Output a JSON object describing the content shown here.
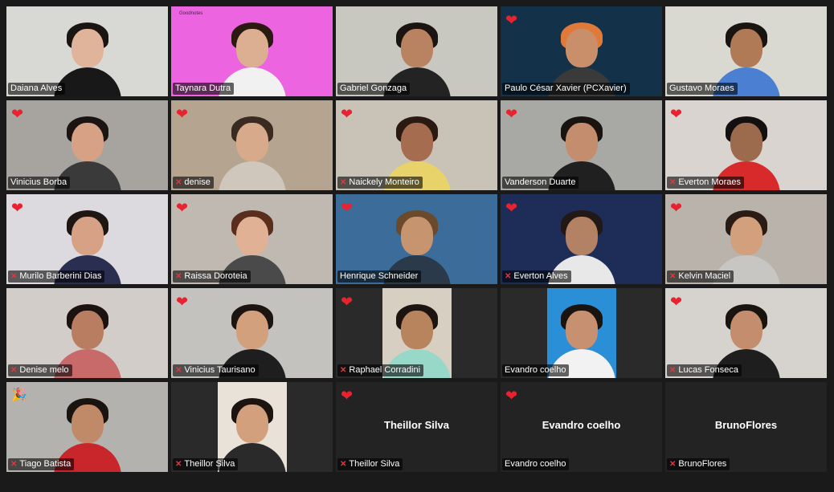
{
  "participants": [
    {
      "name": "Daiana Alves",
      "mic_off": false,
      "reaction": "",
      "active": true,
      "bg": "#d8d8d4",
      "skin": "#e0b49a",
      "hair": "#1a1412",
      "shirt": "#181818"
    },
    {
      "name": "Taynara Dutra",
      "mic_off": false,
      "reaction": "",
      "bg": "#ec64df",
      "skin": "#dcae92",
      "hair": "#2a1a12",
      "shirt": "#f1f1f1",
      "sign": "Goodnotes"
    },
    {
      "name": "Gabriel Gonzaga",
      "mic_off": false,
      "reaction": "",
      "bg": "#c8c8c0",
      "skin": "#b98260",
      "hair": "#1c1410",
      "shirt": "#232323"
    },
    {
      "name": "Paulo César Xavier (PCXavier)",
      "mic_off": false,
      "reaction": "heart",
      "bg": "#13324a",
      "skin": "#c98f6b",
      "hair": "#e07a3a",
      "shirt": "#3a3a3a"
    },
    {
      "name": "Gustavo Moraes",
      "mic_off": false,
      "reaction": "",
      "bg": "#d9d9d2",
      "skin": "#b07a56",
      "hair": "#1a1410",
      "shirt": "#4a7fd1"
    },
    {
      "name": "Vinicius Borba",
      "mic_off": false,
      "reaction": "heart",
      "bg": "#a7a4a0",
      "skin": "#d6a184",
      "hair": "#1b1412",
      "shirt": "#3a3a3a"
    },
    {
      "name": "denise",
      "mic_off": true,
      "reaction": "heart",
      "bg": "#b5a48f",
      "skin": "#d8aa8c",
      "hair": "#3a2a20",
      "shirt": "#cfc7bb"
    },
    {
      "name": "Naickely Monteiro",
      "mic_off": true,
      "reaction": "heart",
      "bg": "#c9c2b6",
      "skin": "#a66c4f",
      "hair": "#2a1a12",
      "shirt": "#e8d36a"
    },
    {
      "name": "Vanderson Duarte",
      "mic_off": false,
      "reaction": "heart",
      "bg": "#a8a8a4",
      "skin": "#c48e6e",
      "hair": "#1a1410",
      "shirt": "#202020"
    },
    {
      "name": "Everton Moraes",
      "mic_off": true,
      "reaction": "heart",
      "bg": "#d9d4cf",
      "skin": "#9c6a4c",
      "hair": "#151010",
      "shirt": "#d82a2a"
    },
    {
      "name": "Murilo Barberini Dias",
      "mic_off": true,
      "reaction": "heart",
      "bg": "#dcdadf",
      "skin": "#d6a184",
      "hair": "#1e1612",
      "shirt": "#2a2f52"
    },
    {
      "name": "Raissa Doroteia",
      "mic_off": true,
      "reaction": "heart",
      "bg": "#bfb9b2",
      "skin": "#e0b195",
      "hair": "#5a2e1c",
      "shirt": "#4a4a4a"
    },
    {
      "name": "Henrique Schneider",
      "mic_off": false,
      "reaction": "heart",
      "bg": "#3c6c9a",
      "skin": "#c79470",
      "hair": "#6a4a2a",
      "shirt": "#2a3a4a"
    },
    {
      "name": "Everton Alves",
      "mic_off": true,
      "reaction": "heart",
      "bg": "#1d2d58",
      "skin": "#b38164",
      "hair": "#221815",
      "shirt": "#e8e8e8"
    },
    {
      "name": "Kelvin Maciel",
      "mic_off": true,
      "reaction": "heart",
      "bg": "#b9b3ac",
      "skin": "#d3a07e",
      "hair": "#2a1c14",
      "shirt": "#c8c6c2"
    },
    {
      "name": "Denise melo",
      "mic_off": true,
      "reaction": "",
      "bg": "#d2cdc8",
      "skin": "#b97e62",
      "hair": "#1c1210",
      "shirt": "#c86a6a"
    },
    {
      "name": "Vinicius Taurisano",
      "mic_off": true,
      "reaction": "heart",
      "bg": "#c4c2bf",
      "skin": "#d3a07e",
      "hair": "#1c1410",
      "shirt": "#1e1e1e"
    },
    {
      "name": "Raphael Corradini",
      "mic_off": true,
      "reaction": "heart",
      "bg": "#d7cfc2",
      "skin": "#b7845e",
      "hair": "#1c1410",
      "shirt": "#98d8c8",
      "box": true
    },
    {
      "name": "Evandro coelho",
      "mic_off": false,
      "reaction": "",
      "bg": "#2a8fd6",
      "skin": "#c79070",
      "hair": "#1a1410",
      "shirt": "#f2f2f2",
      "box": true
    },
    {
      "name": "Lucas Fonseca",
      "mic_off": true,
      "reaction": "heart",
      "bg": "#d6d3ce",
      "skin": "#c48e6e",
      "hair": "#1a1410",
      "shirt": "#1e1e1e"
    },
    {
      "name": "Tiago Batista",
      "mic_off": true,
      "reaction": "party",
      "bg": "#b4b2ae",
      "skin": "#c08a68",
      "hair": "#1a1410",
      "shirt": "#c8262a"
    },
    {
      "name": "Theillor Silva",
      "mic_off": true,
      "reaction": "",
      "bg": "#e8e2d8",
      "skin": "#d3a07e",
      "hair": "#1c1410",
      "shirt": "#2a2a2a",
      "box": true
    },
    {
      "name": "Theillor Silva",
      "mic_off": true,
      "reaction": "heart",
      "video_off": true
    },
    {
      "name": "Evandro coelho",
      "mic_off": false,
      "reaction": "heart",
      "video_off": true
    },
    {
      "name": "BrunoFlores",
      "mic_off": true,
      "reaction": "",
      "video_off": true
    }
  ]
}
